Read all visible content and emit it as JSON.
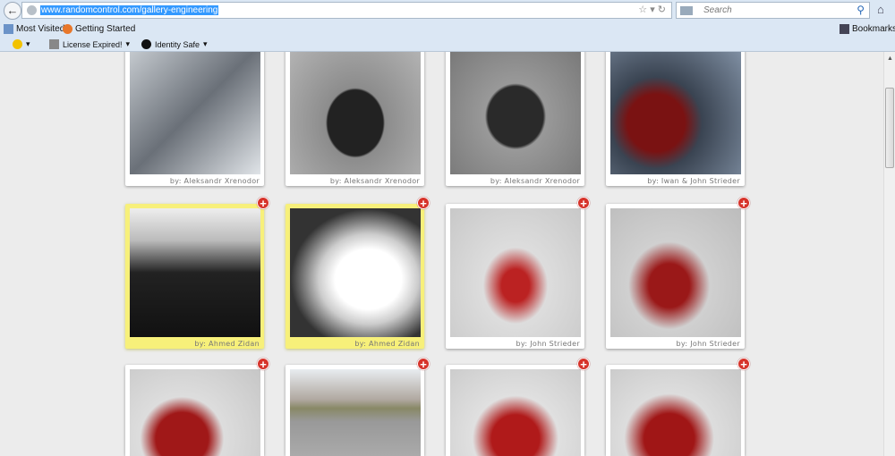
{
  "browser": {
    "url": "www.randomcontrol.com/gallery-engineering",
    "search_placeholder": "Search",
    "bookmarks": [
      "Most Visited",
      "Getting Started"
    ],
    "bookmarks_menu": "Bookmarks",
    "addons": {
      "license": "License Expired!",
      "identity": "Identity Safe"
    }
  },
  "gallery": {
    "add_icon": "+",
    "rows": [
      [
        {
          "caption": "by: Aleksandr Xrenodor",
          "img": "linear-gradient(135deg,#c8cdd2,#6a7078 50%,#e0e4e8)"
        },
        {
          "caption": "by: Aleksandr Xrenodor",
          "img": "radial-gradient(ellipse at 50% 60%,#222 30%,#8c8c8c 32%,#b5b5b5)"
        },
        {
          "caption": "by: Aleksandr Xrenodor",
          "img": "radial-gradient(ellipse at 50% 55%,#2a2a2a 30%,#999 33%,#777)"
        },
        {
          "caption": "by: Iwan & John Strieder",
          "img": "radial-gradient(circle at 35% 60%,#7a1212 25%,#3a4452 40%,#8494a8)"
        }
      ],
      [
        {
          "caption": "by: Ahmed Zidan",
          "img": "linear-gradient(180deg,#eee 0%,#bbb 25%,#222 50%,#111)",
          "hl": true
        },
        {
          "caption": "by: Ahmed Zidan",
          "img": "radial-gradient(ellipse at 60% 55%,#fff 30%,#ccc 45%,#333 70%)",
          "hl": true
        },
        {
          "caption": "by: John Strieder",
          "img": "radial-gradient(ellipse at 50% 60%,#b22 15%,#ddd 35%,#c8c8c8)"
        },
        {
          "caption": "by: John Strieder",
          "img": "radial-gradient(ellipse at 45% 60%,#9a1818 20%,#d0d0d0 40%,#bcbcbc)"
        }
      ],
      [
        {
          "caption": "",
          "img": "radial-gradient(circle at 40% 80%,#a01818 25%,#ddd 40%,#c6c6c6)"
        },
        {
          "caption": "",
          "img": "linear-gradient(180deg,#e8ecf0 0%,#b0a8a0 35%,#886 45%,#999 60%,#aaa)"
        },
        {
          "caption": "",
          "img": "radial-gradient(circle at 50% 80%,#b01a1a 25%,#e0e0e0 45%,#ccc)"
        },
        {
          "caption": "",
          "img": "radial-gradient(circle at 45% 80%,#a01616 25%,#ddd 45%,#c8c8c8)"
        }
      ]
    ]
  }
}
